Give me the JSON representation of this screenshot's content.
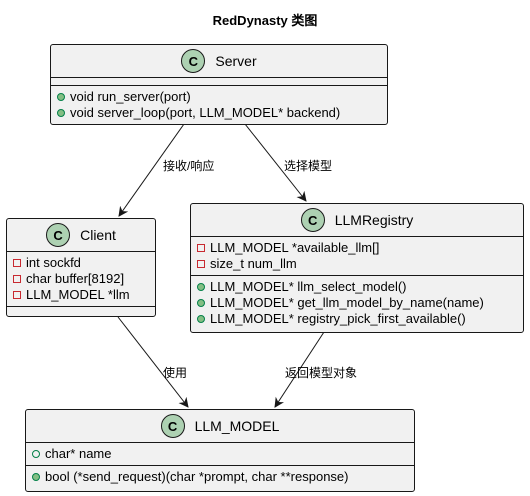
{
  "title": "RedDynasty 类图",
  "classes": {
    "server": {
      "name": "Server",
      "badge": "C",
      "attributes": [],
      "methods": [
        "void run_server(port)",
        "void server_loop(port, LLM_MODEL* backend)"
      ]
    },
    "client": {
      "name": "Client",
      "badge": "C",
      "attributes": [
        "int sockfd",
        "char buffer[8192]",
        "LLM_MODEL *llm"
      ],
      "methods": []
    },
    "registry": {
      "name": "LLMRegistry",
      "badge": "C",
      "attributes": [
        "LLM_MODEL *available_llm[]",
        "size_t num_llm"
      ],
      "methods": [
        "LLM_MODEL* llm_select_model()",
        "LLM_MODEL* get_llm_model_by_name(name)",
        "LLM_MODEL* registry_pick_first_available()"
      ]
    },
    "model": {
      "name": "LLM_MODEL",
      "badge": "C",
      "attributes": [
        "char* name"
      ],
      "methods": [
        "bool (*send_request)(char *prompt, char **response)"
      ]
    }
  },
  "edges": {
    "server_client": "接收/响应",
    "server_registry": "选择模型",
    "client_model": "使用",
    "registry_model": "返回模型对象"
  },
  "colors": {
    "box_fill": "#f1f1f1",
    "border": "#181818",
    "badge": "#add1b2",
    "public": "#84be84",
    "private": "#c82930"
  }
}
